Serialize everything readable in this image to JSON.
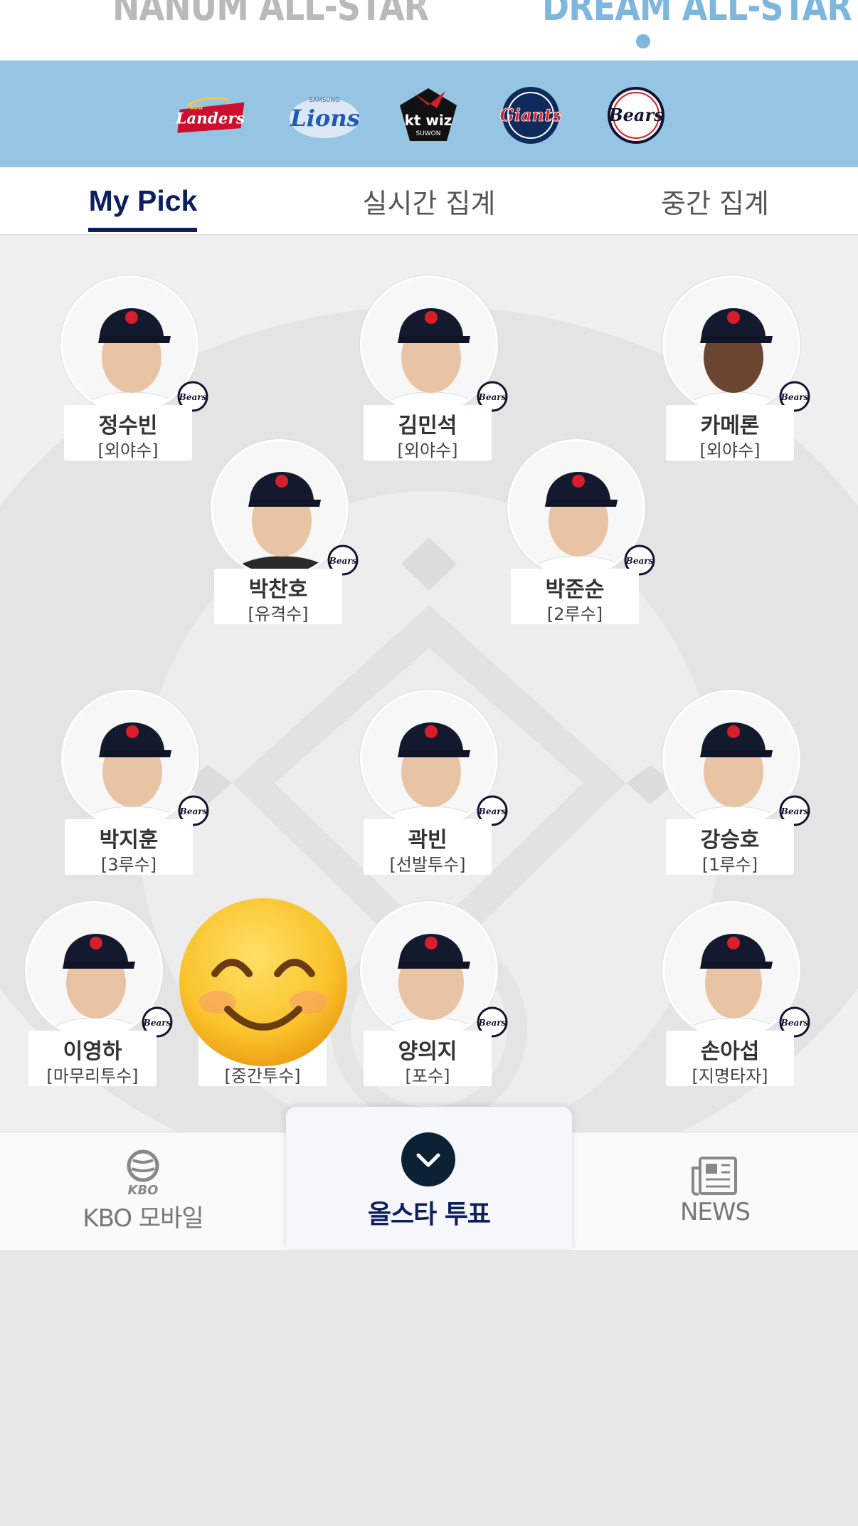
{
  "header": {
    "league_left": "NANUM ALL-STAR",
    "league_right": "DREAM ALL-STAR",
    "selected_league": "DREAM ALL-STAR"
  },
  "teams": [
    {
      "name": "SSG Landers",
      "logo": "SSG Landers logo",
      "color": "#ce0e2d"
    },
    {
      "name": "Samsung Lions",
      "logo": "Lions logo",
      "color": "#1f5bb4"
    },
    {
      "name": "kt wiz suwon",
      "logo": "kt wiz logo",
      "color": "#111111"
    },
    {
      "name": "Lotte Giants",
      "logo": "Giants logo",
      "color": "#d81e2a"
    },
    {
      "name": "Doosan Bears",
      "logo": "Bears logo",
      "color": "#131230"
    }
  ],
  "tabs": [
    {
      "label": "My Pick",
      "active": true
    },
    {
      "label": "실시간 집계",
      "active": false
    },
    {
      "label": "중간 집계",
      "active": false
    }
  ],
  "players": [
    {
      "name": "정수빈",
      "position": "[외야수]"
    },
    {
      "name": "김민석",
      "position": "[외야수]"
    },
    {
      "name": "카메론",
      "position": "[외야수]"
    },
    {
      "name": "박찬호",
      "position": "[유격수]"
    },
    {
      "name": "박준순",
      "position": "[2루수]"
    },
    {
      "name": "박지훈",
      "position": "[3루수]"
    },
    {
      "name": "곽빈",
      "position": "[선발투수]"
    },
    {
      "name": "강승호",
      "position": "[1루수]"
    },
    {
      "name": "이영하",
      "position": "[마무리투수]"
    },
    {
      "name": "",
      "position": "[중간투수]"
    },
    {
      "name": "양의지",
      "position": "[포수]"
    },
    {
      "name": "손아섭",
      "position": "[지명타자]"
    }
  ],
  "badge_text": "Bears",
  "overlay_emoji": "😊",
  "bottom_nav": {
    "kbo_logo_text": "KBO",
    "kbo_label": "KBO 모바일",
    "vote_label": "올스타 투표",
    "news_label": "NEWS"
  },
  "colors": {
    "navy": "#0d1f5c",
    "sky": "#96c4e3",
    "field": "#efefef"
  }
}
